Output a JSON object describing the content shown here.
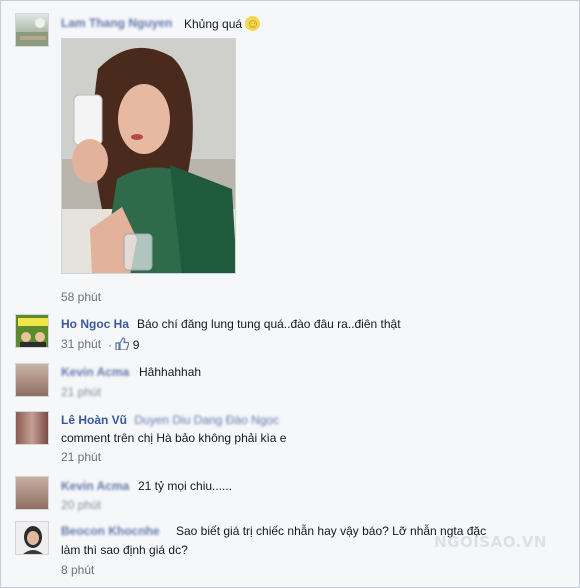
{
  "comments": [
    {
      "name": "Lam Thang Nguyen",
      "text": "Khủng quá",
      "emoji": "☺",
      "time": "58 phút"
    },
    {
      "name": "Ho Ngoc Ha",
      "text": "Báo chí đăng lung tung quá..đào đâu ra..điên thật",
      "time": "31 phút",
      "likes": "9"
    },
    {
      "name": "Kevin Acma",
      "text": "Hâhhahhah",
      "time": "21 phút"
    },
    {
      "name": "Lê Hoàn Vũ",
      "tagged": "Duyen Diu Dang Đào Ngọc",
      "text": "comment trên chị Hà bảo không phải kìa e",
      "time": "21 phút"
    },
    {
      "name": "Kevin Acma",
      "text": "21 tỷ mọi chiu......",
      "time": "20 phút"
    },
    {
      "name": "Beocon Khocnhe",
      "text_line1": "Sao biết giá trị chiếc nhẫn hay vậy báo? Lỡ nhẫn ngta đặc",
      "text_line2": "làm thì sao định giá dc?",
      "time": "8 phút"
    }
  ],
  "watermark": "NGOISAO.VN"
}
